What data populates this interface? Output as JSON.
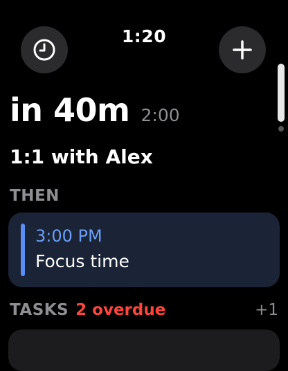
{
  "status": {
    "time": "1:20",
    "left_icon": "clock-icon",
    "right_icon": "plus-icon"
  },
  "next_event": {
    "countdown": "in 40m",
    "time": "2:00",
    "title": "1:1 with Alex"
  },
  "then": {
    "heading": "THEN",
    "event": {
      "time": "3:00 PM",
      "title": "Focus time",
      "accent_color": "#5a8ef5"
    }
  },
  "tasks": {
    "label": "TASKS",
    "overdue": "2 overdue",
    "extra": "+1",
    "overdue_color": "#ff453a"
  }
}
